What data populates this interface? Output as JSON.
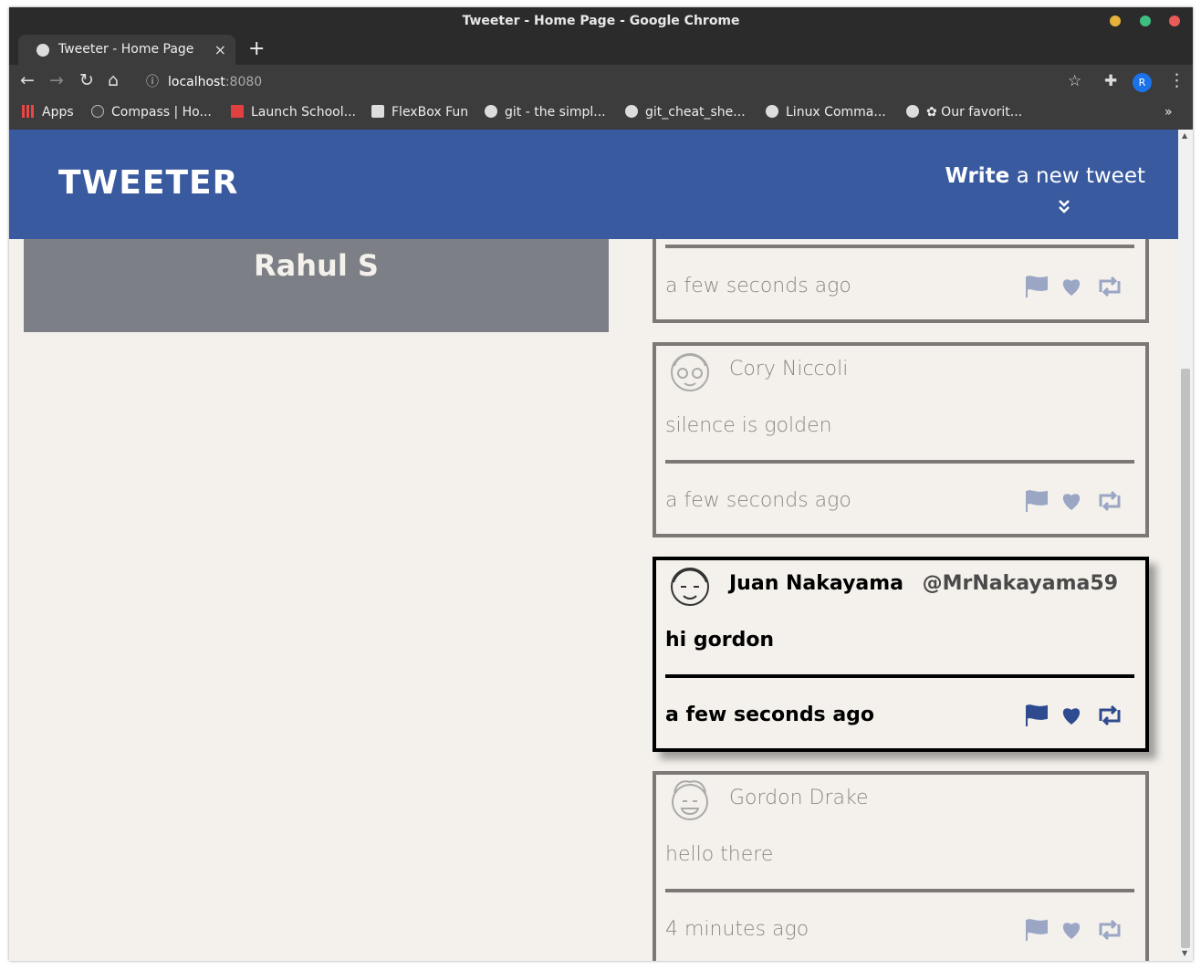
{
  "window": {
    "title": "Tweeter - Home Page - Google Chrome",
    "dot_colors": [
      "#e6b23a",
      "#3fbf7f",
      "#e95b57"
    ]
  },
  "tab": {
    "title": "Tweeter - Home Page",
    "close": "×",
    "new_tab": "+"
  },
  "toolbar": {
    "url_host": "localhost",
    "url_port": ":8080",
    "profile_initial": "R"
  },
  "bookmarks": [
    "Apps",
    "Compass | Ho...",
    "Launch School...",
    "FlexBox Fun",
    "git - the simpl...",
    "git_cheat_she...",
    "Linux Comma...",
    "✿ Our favorit..."
  ],
  "bookmarks_more": "»",
  "nav": {
    "brand": "TWEETER",
    "compose_bold": "Write",
    "compose_rest": " a new tweet"
  },
  "profile": {
    "name": "Rahul S"
  },
  "colors": {
    "accent": "#3a5a9f",
    "page_bg": "#f4f1ec",
    "border": "#7c7875",
    "icon_dim": "#9aa6c4"
  },
  "tweets": [
    {
      "time": "a few seconds ago"
    },
    {
      "name": "Cory Niccoli",
      "handle": "",
      "text": "silence is golden",
      "time": "a few seconds ago"
    },
    {
      "name": "Juan Nakayama",
      "handle": "@MrNakayama59",
      "text": "hi gordon",
      "time": "a few seconds ago"
    },
    {
      "name": "Gordon Drake",
      "handle": "",
      "text": "hello there",
      "time": "4 minutes ago"
    }
  ]
}
